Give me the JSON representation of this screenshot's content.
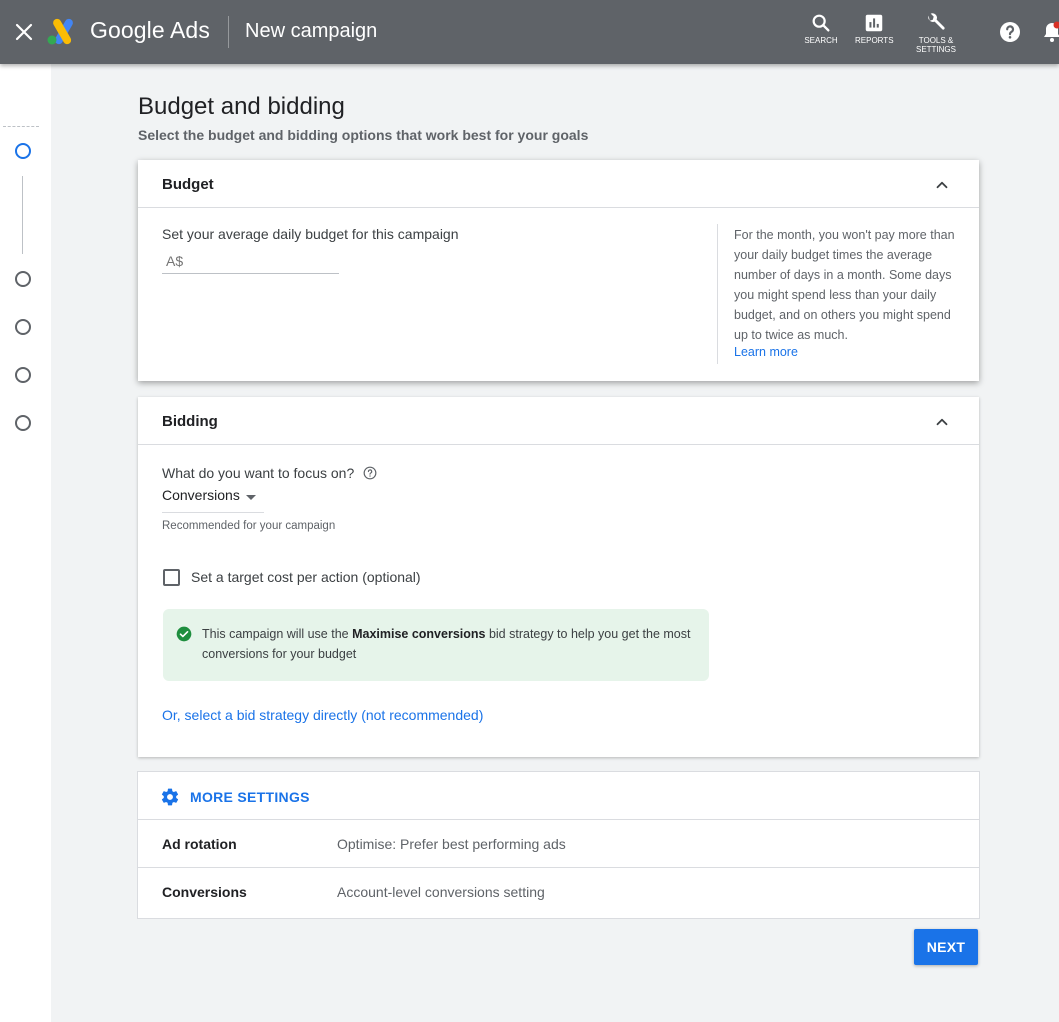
{
  "topbar": {
    "brand": "Google Ads",
    "page_title": "New campaign",
    "tools": [
      {
        "label": "SEARCH",
        "icon": "search-icon"
      },
      {
        "label": "REPORTS",
        "icon": "reports-icon"
      },
      {
        "label": "TOOLS &",
        "label2": "SETTINGS",
        "icon": "wrench-icon"
      }
    ],
    "help_icon": "help-icon",
    "bell_icon": "bell-icon"
  },
  "left_rail": {
    "steps": 5,
    "active_step": 1
  },
  "page": {
    "title": "Budget and bidding",
    "subtitle": "Select the budget and bidding options that work best for your goals"
  },
  "budget": {
    "title": "Budget",
    "label": "Set your average daily budget for this campaign",
    "currency_placeholder": "A$",
    "value": "",
    "help_text": "For the month, you won't pay more than your daily budget times the average number of days in a month. Some days you might spend less than your daily budget, and on others you might spend up to twice as much.",
    "learn_more": "Learn more"
  },
  "bidding": {
    "title": "Bidding",
    "focus_label": "What do you want to focus on?",
    "focus_value": "Conversions",
    "recommended": "Recommended for your campaign",
    "target_cpa_label": "Set a target cost per action (optional)",
    "target_cpa_checked": false,
    "info_prefix": "This campaign will use the ",
    "info_strategy": "Maximise conversions",
    "info_suffix": " bid strategy to help you get the most conversions for your budget",
    "alt_link": "Or, select a bid strategy directly (not recommended)"
  },
  "more_settings": {
    "title": "MORE SETTINGS",
    "rows": [
      {
        "label": "Ad rotation",
        "value": "Optimise: Prefer best performing ads"
      },
      {
        "label": "Conversions",
        "value": "Account-level conversions setting"
      }
    ]
  },
  "footer": {
    "next_label": "NEXT"
  },
  "colors": {
    "topbar": "#5f6368",
    "accent": "#1a73e8",
    "success_bg": "#e6f4ea",
    "success_icon": "#1e8e3e",
    "page_bg": "#f1f3f4"
  }
}
